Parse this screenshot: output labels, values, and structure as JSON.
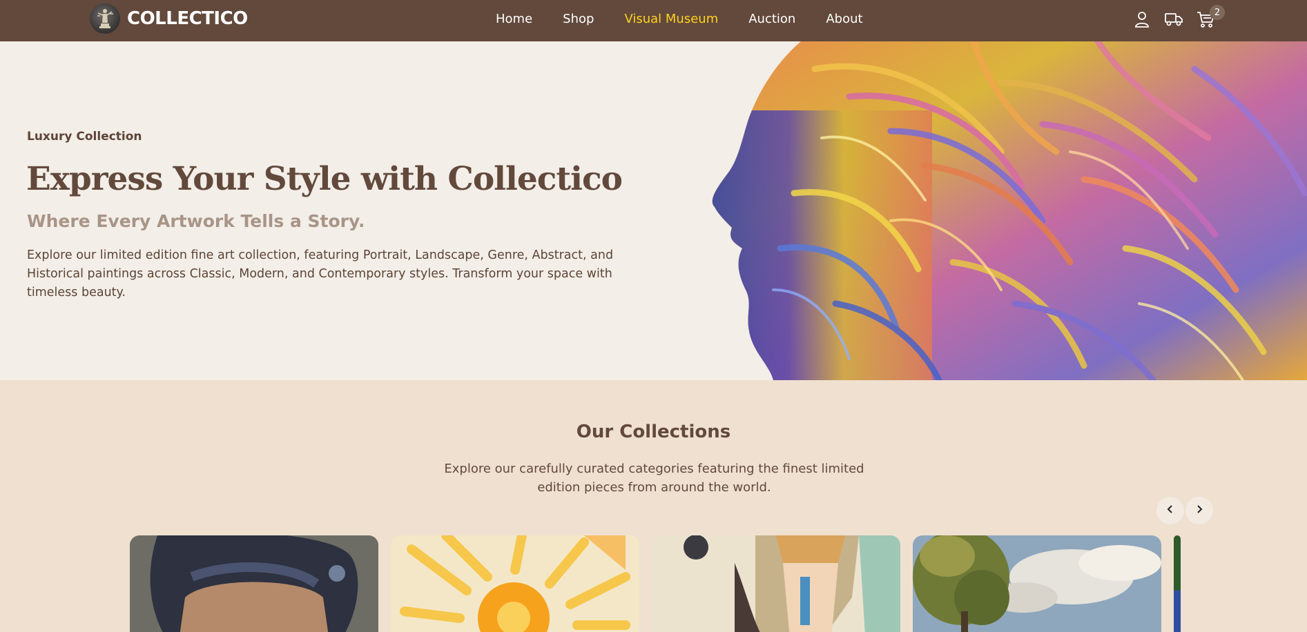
{
  "brand": {
    "name": "COLLECTICO",
    "logo_icon": "statue-logo-icon"
  },
  "nav": {
    "items": [
      {
        "label": "Home"
      },
      {
        "label": "Shop"
      },
      {
        "label": "Visual Museum"
      },
      {
        "label": "Auction"
      },
      {
        "label": "About"
      }
    ],
    "active": "Visual Museum",
    "active_color": "#ffd21f",
    "icons": [
      "user-icon",
      "truck-icon",
      "cart-icon"
    ],
    "cart_count": "2"
  },
  "hero": {
    "eyebrow": "Luxury Collection",
    "title": "Express Your Style with Collectico",
    "subtitle": "Where Every Artwork Tells a Story.",
    "description": "Explore our limited edition fine art collection, featuring Portrait, Landscape, Genre, Abstract, and Historical paintings across Classic, Modern, and Contemporary styles. Transform your space with timeless beauty."
  },
  "collections": {
    "title": "Our Collections",
    "description": "Explore our carefully curated categories featuring the finest limited edition pieces from around the world.",
    "cards": [
      {
        "art": "portrait-painting"
      },
      {
        "art": "sun-painting"
      },
      {
        "art": "abstract-face-painting"
      },
      {
        "art": "landscape-tree-painting"
      }
    ]
  },
  "colors": {
    "nav_bg": "#62493c",
    "hero_bg": "#f3eee8",
    "section_bg": "#efe0d0",
    "heading": "#62493c"
  }
}
